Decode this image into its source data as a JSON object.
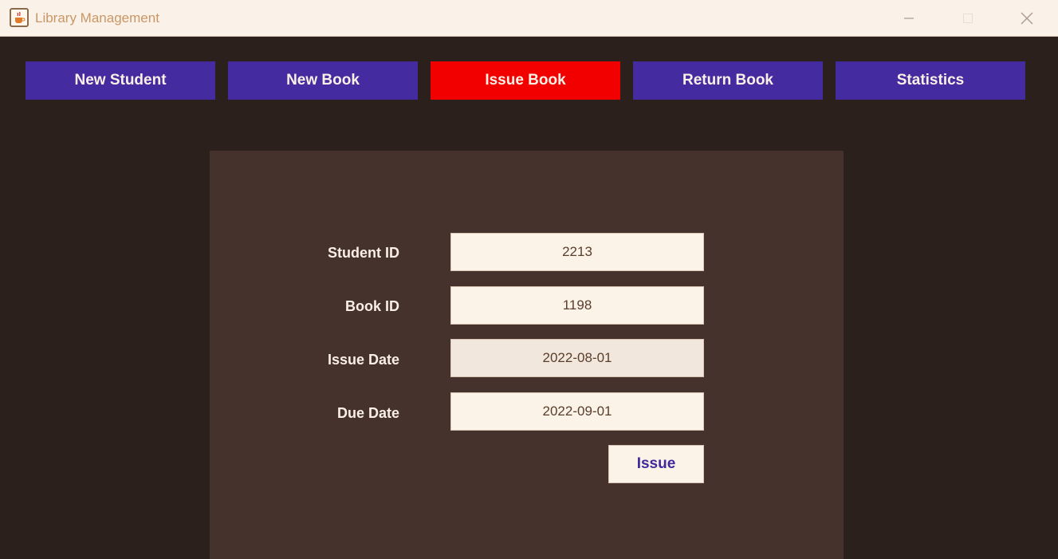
{
  "window": {
    "title": "Library Management",
    "icon": "java-cup-icon"
  },
  "nav": {
    "items": [
      {
        "label": "New Student"
      },
      {
        "label": "New Book"
      },
      {
        "label": "Issue Book",
        "active": true
      },
      {
        "label": "Return Book"
      },
      {
        "label": "Statistics"
      }
    ]
  },
  "form": {
    "student_id": {
      "label": "Student ID",
      "value": "2213"
    },
    "book_id": {
      "label": "Book ID",
      "value": "1198"
    },
    "issue_date": {
      "label": "Issue Date",
      "value": "2022-08-01"
    },
    "due_date": {
      "label": "Due Date",
      "value": "2022-09-01"
    },
    "submit_label": "Issue"
  },
  "colors": {
    "background": "#2c201d",
    "panel": "#45322c",
    "nav_button": "#452ba0",
    "nav_button_active": "#f20000",
    "field_background": "#fbf2e8",
    "label_text": "#f9efe7",
    "issue_button_text": "#3e2a9a"
  }
}
